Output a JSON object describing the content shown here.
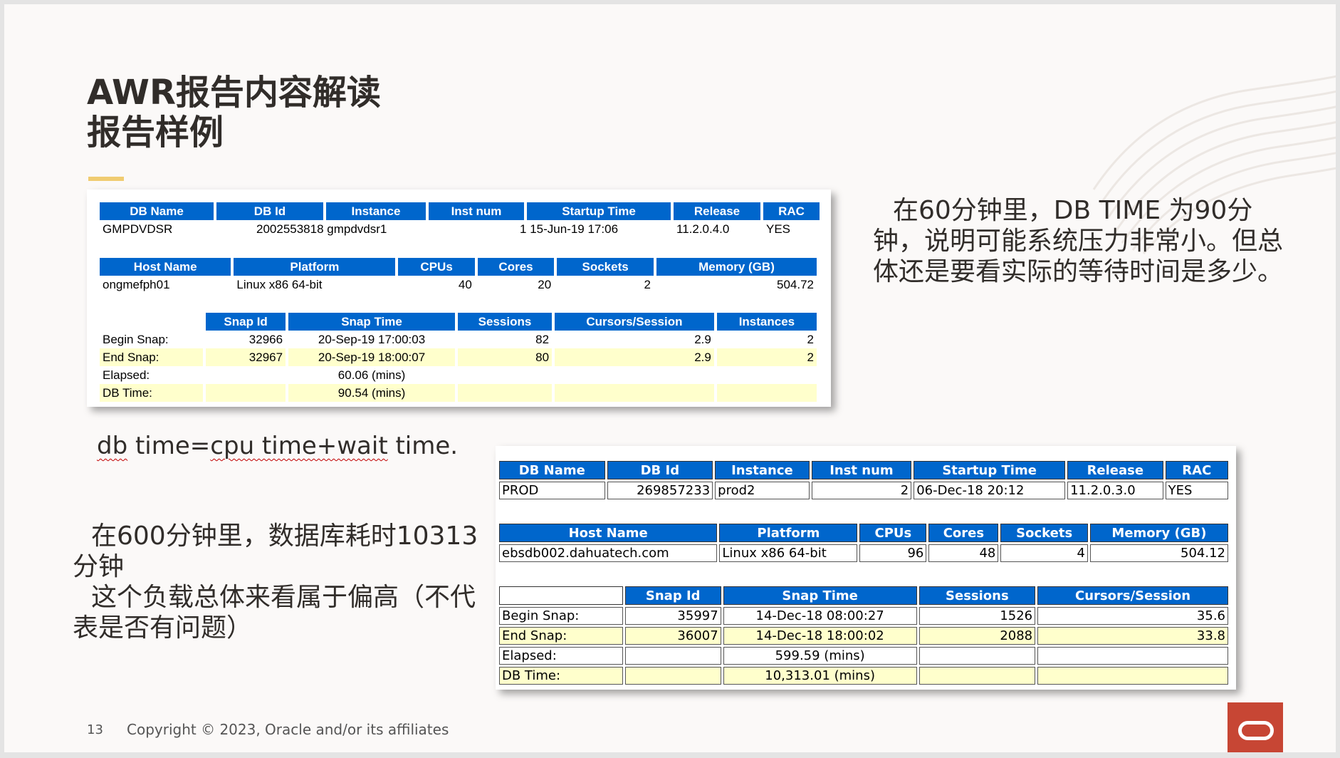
{
  "slide": {
    "title_line1": "AWR报告内容解读",
    "title_line2": "报告样例",
    "note_right": "在60分钟里，DB TIME 为90分钟，说明可能系统压力非常小。但总体还是要看实际的等待时间是多少。",
    "formula": {
      "p1": "db",
      "p2": " time=",
      "p3": "cpu time+wait",
      "p4": " time."
    },
    "note_left_1": "在600分钟里，数据库耗时10313分钟",
    "note_left_2": "这个负载总体来看属于偏高（不代表是否有问题）",
    "footer_page": "13",
    "footer_copyright": "Copyright © 2023, Oracle and/or its affiliates",
    "logo_icon": "oracle-logo-icon",
    "accent_color": "#f0cc71",
    "header_color": "#0066cc",
    "highlight_color": "#ffffcc"
  },
  "report1": {
    "db_headers": [
      "DB Name",
      "DB Id",
      "Instance",
      "Inst num",
      "Startup Time",
      "Release",
      "RAC"
    ],
    "db_row": [
      "GMPDVDSR",
      "2002553818",
      "gmpdvdsr1",
      "1",
      "15-Jun-19 17:06",
      "11.2.0.4.0",
      "YES"
    ],
    "host_headers": [
      "Host Name",
      "Platform",
      "CPUs",
      "Cores",
      "Sockets",
      "Memory (GB)"
    ],
    "host_row": [
      "ongmefph01",
      "Linux x86 64-bit",
      "40",
      "20",
      "2",
      "504.72"
    ],
    "snap_headers": [
      "Snap Id",
      "Snap Time",
      "Sessions",
      "Cursors/Session",
      "Instances"
    ],
    "snap_rows": [
      {
        "label": "Begin Snap:",
        "id": "32966",
        "time": "20-Sep-19 17:00:03",
        "sessions": "82",
        "cursors": "2.9",
        "instances": "2"
      },
      {
        "label": "End Snap:",
        "id": "32967",
        "time": "20-Sep-19 18:00:07",
        "sessions": "80",
        "cursors": "2.9",
        "instances": "2"
      },
      {
        "label": "Elapsed:",
        "id": "",
        "time": "60.06 (mins)",
        "sessions": "",
        "cursors": "",
        "instances": ""
      },
      {
        "label": "DB Time:",
        "id": "",
        "time": "90.54 (mins)",
        "sessions": "",
        "cursors": "",
        "instances": ""
      }
    ]
  },
  "report2": {
    "db_headers": [
      "DB Name",
      "DB Id",
      "Instance",
      "Inst num",
      "Startup Time",
      "Release",
      "RAC"
    ],
    "db_row": [
      "PROD",
      "269857233",
      "prod2",
      "2",
      "06-Dec-18 20:12",
      "11.2.0.3.0",
      "YES"
    ],
    "host_headers": [
      "Host Name",
      "Platform",
      "CPUs",
      "Cores",
      "Sockets",
      "Memory (GB)"
    ],
    "host_row": [
      "ebsdb002.dahuatech.com",
      "Linux x86 64-bit",
      "96",
      "48",
      "4",
      "504.12"
    ],
    "snap_headers": [
      "Snap Id",
      "Snap Time",
      "Sessions",
      "Cursors/Session"
    ],
    "snap_rows": [
      {
        "label": "Begin Snap:",
        "id": "35997",
        "time": "14-Dec-18 08:00:27",
        "sessions": "1526",
        "cursors": "35.6"
      },
      {
        "label": "End Snap:",
        "id": "36007",
        "time": "14-Dec-18 18:00:02",
        "sessions": "2088",
        "cursors": "33.8"
      },
      {
        "label": "Elapsed:",
        "id": "",
        "time": "599.59 (mins)",
        "sessions": "",
        "cursors": ""
      },
      {
        "label": "DB Time:",
        "id": "",
        "time": "10,313.01 (mins)",
        "sessions": "",
        "cursors": ""
      }
    ]
  }
}
